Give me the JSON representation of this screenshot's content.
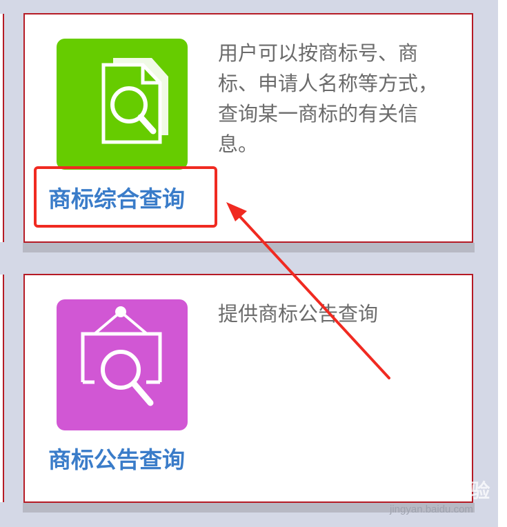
{
  "cards": [
    {
      "title": "商标综合查询",
      "description": "用户可以按商标号、商标、申请人名称等方式，查询某一商标的有关信息。",
      "icon": "document-search-icon",
      "icon_color": "#66cc00"
    },
    {
      "title": "商标公告查询",
      "description": "提供商标公告查询",
      "icon": "bulletin-search-icon",
      "icon_color": "#d157d4"
    }
  ],
  "annotation": {
    "highlight_color": "#f02a21"
  },
  "watermark": {
    "logo": "Bai du 经验",
    "url": "jingyan.baidu.com"
  }
}
